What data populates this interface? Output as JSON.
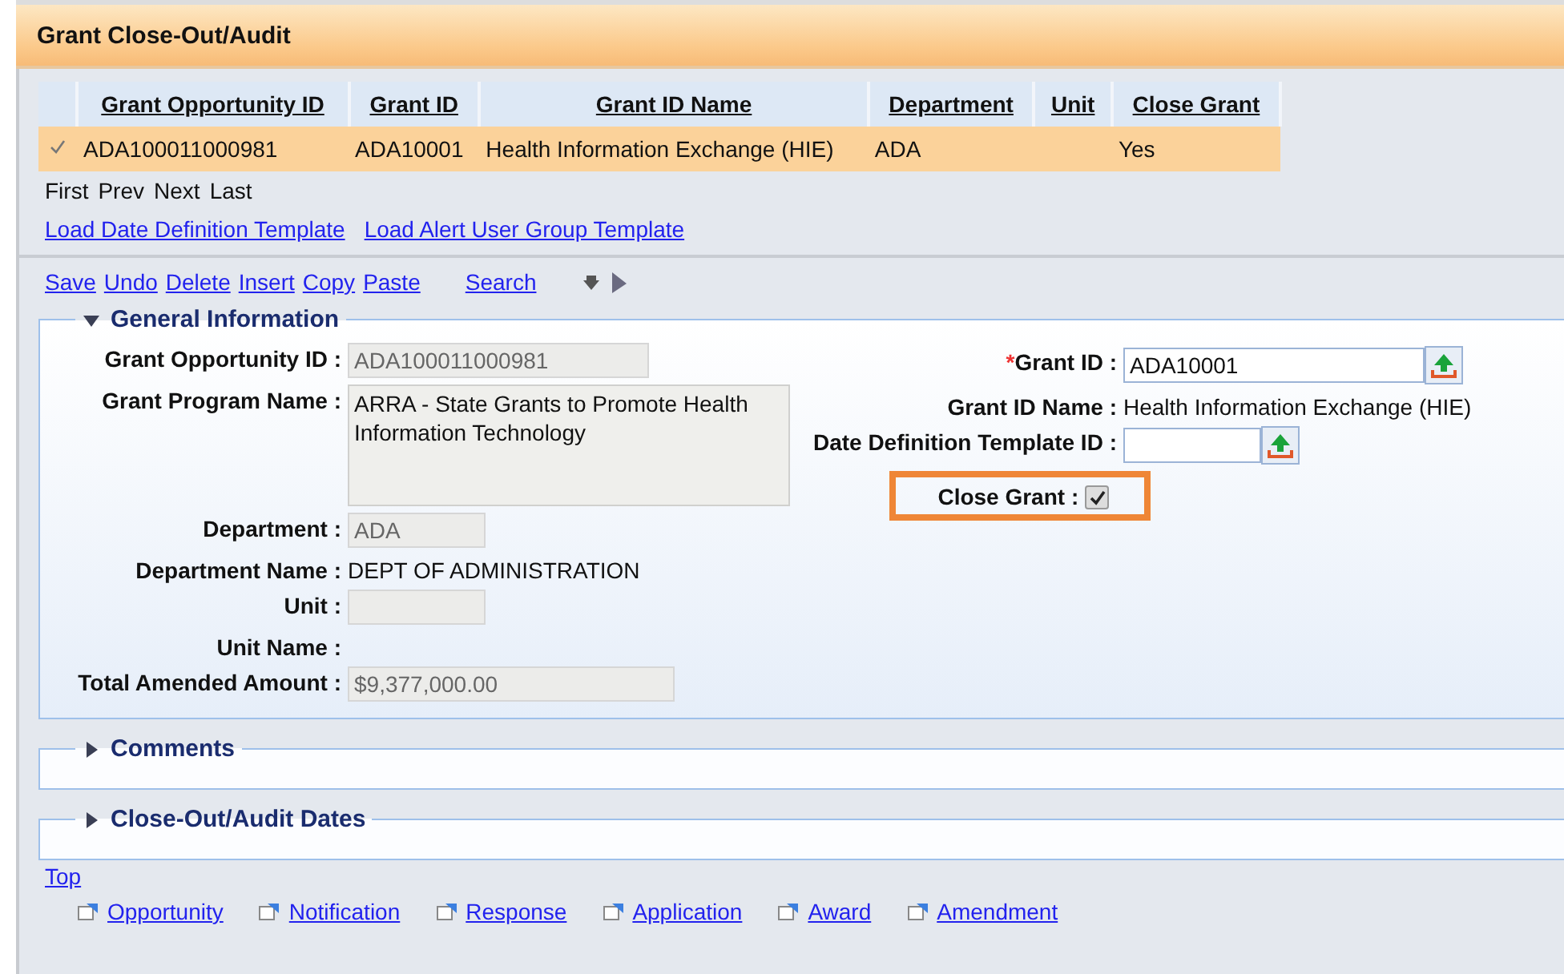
{
  "title": "Grant Close-Out/Audit",
  "table": {
    "columns": [
      {
        "label": "Grant Opportunity ID"
      },
      {
        "label": "Grant ID"
      },
      {
        "label": "Grant ID Name"
      },
      {
        "label": "Department"
      },
      {
        "label": "Unit"
      },
      {
        "label": "Close Grant"
      }
    ],
    "rows": [
      {
        "selected": true,
        "cells": [
          "ADA100011000981",
          "ADA10001",
          "Health Information Exchange (HIE)",
          "ADA",
          "",
          "Yes"
        ]
      }
    ]
  },
  "pager": [
    "First",
    "Prev",
    "Next",
    "Last"
  ],
  "template_links": [
    "Load Date Definition Template",
    "Load Alert User Group Template"
  ],
  "toolbar": [
    "Save",
    "Undo",
    "Delete",
    "Insert",
    "Copy",
    "Paste",
    "Search"
  ],
  "general": {
    "title": "General Information",
    "expanded": true,
    "left_fields": [
      {
        "kind": "input",
        "label": "Grant Opportunity ID :",
        "value": "ADA100011000981"
      },
      {
        "kind": "textarea",
        "label": "Grant Program Name :",
        "value": "ARRA - State Grants to Promote Health Information Technology"
      },
      {
        "kind": "input",
        "label": "Department :",
        "value": "ADA"
      },
      {
        "kind": "text",
        "label": "Department Name :",
        "value": "DEPT OF ADMINISTRATION"
      },
      {
        "kind": "input",
        "label": "Unit :"
      },
      {
        "kind": "text",
        "label": "Unit Name :"
      },
      {
        "kind": "input",
        "label": "Total Amended Amount :",
        "value": "$9,377,000.00"
      }
    ],
    "right_fields": [
      {
        "kind": "lookup",
        "label": "Grant ID :",
        "required_mark": "*",
        "value": "ADA10001",
        "highlighted": false
      },
      {
        "kind": "text",
        "label": "Grant ID Name :",
        "value": "Health Information Exchange (HIE)",
        "highlighted": false
      },
      {
        "kind": "lookup",
        "label": "Date Definition Template ID :",
        "highlighted": false
      },
      {
        "kind": "checkbox",
        "label": "Close Grant :",
        "checked": true,
        "highlighted": true
      }
    ]
  },
  "collapsed_sections": [
    {
      "title": "Comments",
      "expanded": false
    },
    {
      "title": "Close-Out/Audit Dates",
      "expanded": false
    }
  ],
  "top_link": "Top",
  "footer_links": [
    "Opportunity",
    "Notification",
    "Response",
    "Application",
    "Award",
    "Amendment"
  ]
}
